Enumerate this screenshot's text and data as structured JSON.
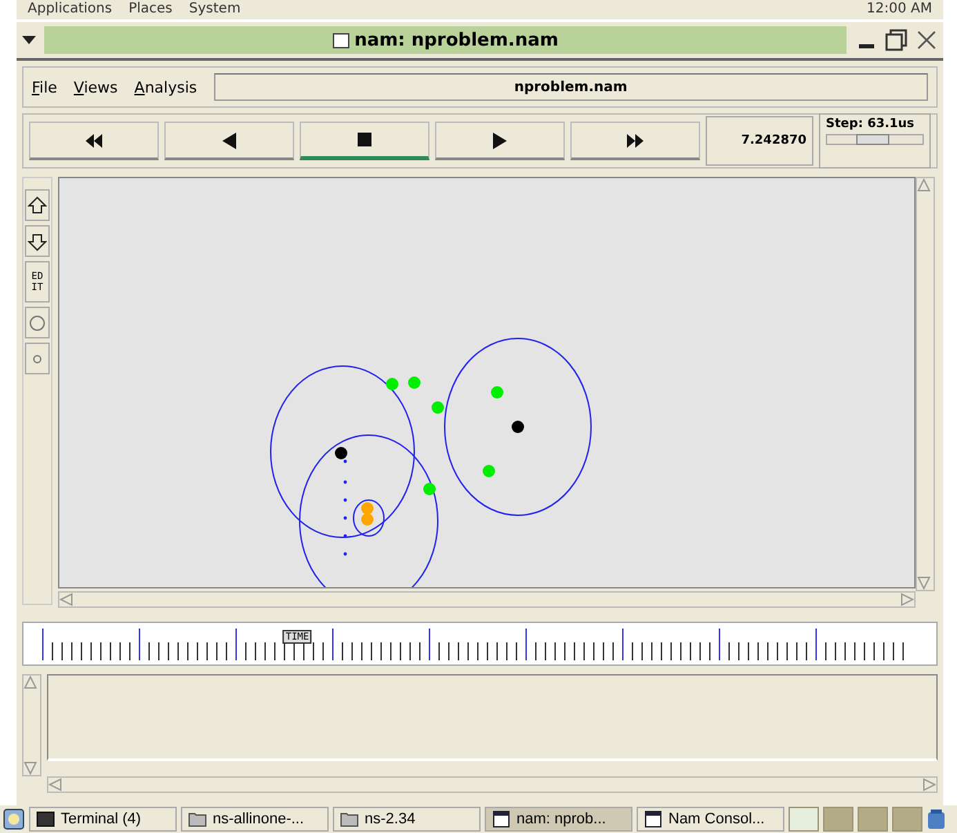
{
  "top_panel": {
    "menus": [
      "Applications",
      "Places",
      "System"
    ],
    "clock": "12:00 AM"
  },
  "window": {
    "title": "nam: nproblem.nam"
  },
  "menu_bar": {
    "items": [
      "File",
      "Views",
      "Analysis"
    ],
    "file_name": "nproblem.nam"
  },
  "transport": {
    "buttons": [
      {
        "kind": "rewind",
        "selected": false
      },
      {
        "kind": "back",
        "selected": false
      },
      {
        "kind": "stop",
        "selected": true
      },
      {
        "kind": "play",
        "selected": false
      },
      {
        "kind": "forward",
        "selected": false
      }
    ],
    "time": "7.242870",
    "step": {
      "label": "Step: 63.1us"
    }
  },
  "tools": [
    {
      "kind": "zoom-in"
    },
    {
      "kind": "zoom-out"
    },
    {
      "kind": "edit",
      "label": "ED IT"
    },
    {
      "kind": "circle"
    },
    {
      "kind": "dot"
    }
  ],
  "nodes": [
    {
      "color": "#00ee00"
    },
    {
      "color": "#00ee00"
    },
    {
      "color": "#00ee00"
    },
    {
      "color": "#00ee00"
    },
    {
      "color": "#00ee00"
    },
    {
      "color": "#00ee00"
    },
    {
      "color": "#000000"
    },
    {
      "color": "#000000"
    },
    {
      "color": "#ffa500"
    },
    {
      "color": "#ffa500"
    }
  ],
  "timeline": {
    "marker": "TIME",
    "level": 0.3
  },
  "taskbar": {
    "items": [
      {
        "kind": "terminal",
        "label": "Terminal (4)",
        "selected": false
      },
      {
        "kind": "folder",
        "label": "ns-allinone-...",
        "selected": false
      },
      {
        "kind": "folder",
        "label": "ns-2.34",
        "selected": false
      },
      {
        "kind": "window",
        "label": "nam: nprob...",
        "selected": true
      },
      {
        "kind": "window",
        "label": "Nam Consol...",
        "selected": false
      }
    ],
    "workspaces": [
      {
        "selected": true
      },
      {
        "selected": false
      },
      {
        "selected": false
      },
      {
        "selected": false
      }
    ]
  }
}
